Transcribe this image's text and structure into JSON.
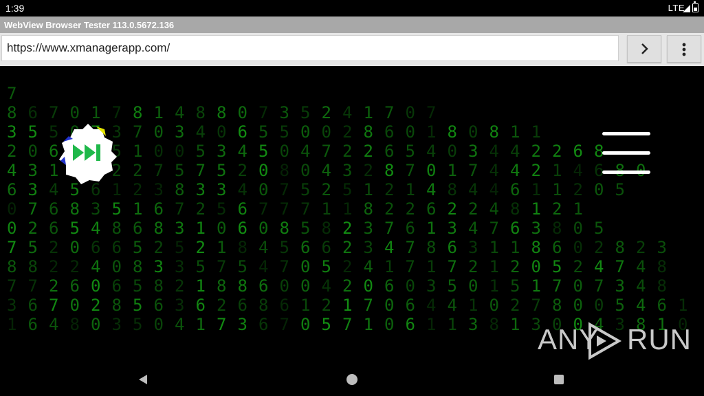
{
  "status_bar": {
    "time": "1:39",
    "network": "LTE"
  },
  "window": {
    "title": "WebView Browser Tester 113.0.5672.136"
  },
  "address_bar": {
    "url": "https://www.xmanagerapp.com/"
  },
  "icons": {
    "go": "chevron-right-icon",
    "menu": "vertical-ellipsis-icon",
    "site_logo": "gear-fast-forward-icon",
    "site_menu": "hamburger-menu-icon",
    "back": "triangle-back-icon",
    "home": "circle-home-icon",
    "recent": "square-recents-icon"
  },
  "colors": {
    "matrix_green": "#19c319",
    "title_bar": "#a8a8a8",
    "logo_arrows": "#1fb84a"
  },
  "watermark": {
    "left": "ANY",
    "right": "RUN"
  },
  "matrix_rows": [
    "7",
    "8 6 7 0 1 7 8 1 4 8 8 0 7 3 5 2 4 1 7 0 7",
    "3 5 5 0 7 3 7 0 3 4 0 6 5 5 0 0 2 8 6 0 1 8 0 8 1 1",
    "2 0 6 8 3 5 1 0 0 5 3 4 5 0 4 7 2 2 6 5 4 0 3 4 4 2 2 6 8",
    "4 3 1 0 4 2 2 7 5 7 5 2 0 8 0 4 3 2 8 7 0 1 7 4 4 2 1 4 6 8 0",
    "6 3 4 5 6 1 2 3 8 3 3 4 0 7 5 2 5 1 2 1 4 8 4 4 6 1 1 2 0 5",
    "0 7 6 8 3 5 1 6 7 2 5 6 7 7 7 1 1 8 2 2 6 2 2 4 8 1 2 1",
    "0 2 6 5 4 8 6 8 3 1 0 6 0 8 5 8 2 3 7 6 1 3 4 7 6 3 8 0 5",
    "7 5 2 0 6 6 5 2 5 2 1 8 4 5 6 6 2 3 4 7 8 6 3 1 1 8 6 0 2 8 2 3",
    "8 8 2 2 4 0 8 3 3 5 7 5 4 7 0 5 2 4 1 7 1 7 2 1 2 0 5 2 4 7 4 8",
    "7 7 2 6 0 6 5 8 2 1 8 8 6 0 0 4 2 0 6 0 3 5 0 1 5 1 7 0 7 3 4 8",
    "3 6 7 0 2 8 5 6 3 6 2 6 8 6 1 2 1 7 0 6 4 4 1 0 2 7 8 0 0 5 4 6 1 2",
    "1 6 4 8 0 3 5 0 4 1 7 3 6 7 0 5 7 1 0 6 1 1 3 8 1 3 0 0 4 3 8 1 0"
  ]
}
